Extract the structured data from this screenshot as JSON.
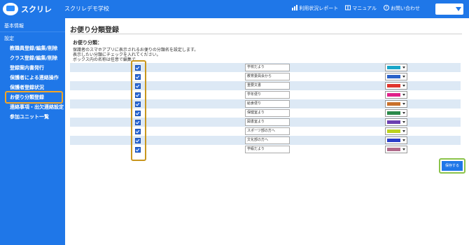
{
  "header": {
    "app_name": "スクリレ",
    "school_name": "スクリレデモ学校",
    "links": [
      {
        "label": "利用状況レポート",
        "icon": "chart-icon"
      },
      {
        "label": "マニュアル",
        "icon": "book-icon"
      },
      {
        "label": "お問い合わせ",
        "icon": "question-icon"
      }
    ]
  },
  "sidebar": {
    "items": [
      {
        "label": "基本情報",
        "type": "head"
      },
      {
        "label": "設定",
        "type": "head"
      },
      {
        "label": "教職員登録/編集/削除",
        "type": "sub"
      },
      {
        "label": "クラス登録/編集/削除",
        "type": "sub"
      },
      {
        "label": "登録案内書発行",
        "type": "sub"
      },
      {
        "label": "保護者による連絡操作",
        "type": "sub"
      },
      {
        "label": "保護者登録状況",
        "type": "sub"
      },
      {
        "label": "お便り分類登録",
        "type": "sub",
        "active": true
      },
      {
        "label": "連絡事項・出欠連絡設定",
        "type": "sub"
      },
      {
        "label": "参加ユニット一覧",
        "type": "sub"
      }
    ]
  },
  "main": {
    "title": "お便り分類登録",
    "section_label": "お便り分類：",
    "desc_lines": [
      "保護者のスマホアプリに表示されるお便りの分類名を設定します。",
      "表示したい分類にチェックを入れてください。",
      "ボックス内の名称は任意で編集で"
    ],
    "rows": [
      {
        "name": "学校だより",
        "checked": true,
        "color": "#1aa6c8"
      },
      {
        "name": "教育委員会から",
        "checked": true,
        "color": "#2a62c9"
      },
      {
        "name": "重要文書",
        "checked": true,
        "color": "#e0342c"
      },
      {
        "name": "学年便り",
        "checked": true,
        "color": "#e0208a"
      },
      {
        "name": "給食便り",
        "checked": true,
        "color": "#c9702a"
      },
      {
        "name": "保健室より",
        "checked": true,
        "color": "#2a8a4a"
      },
      {
        "name": "図書室より",
        "checked": true,
        "color": "#6b3fb0"
      },
      {
        "name": "スポーツ部の方へ",
        "checked": true,
        "color": "#bcd21e"
      },
      {
        "name": "文化部の方へ",
        "checked": true,
        "color": "#2a3fc9"
      },
      {
        "name": "学級だより",
        "checked": true,
        "color": "#b06a8a"
      }
    ],
    "save_label": "保存する"
  },
  "colors": {
    "brand": "#1f77e8",
    "highlight_orange": "#f5a623",
    "highlight_gold": "#c8961e",
    "highlight_green": "#8bc34a",
    "row_alt": "#dde9f5"
  }
}
